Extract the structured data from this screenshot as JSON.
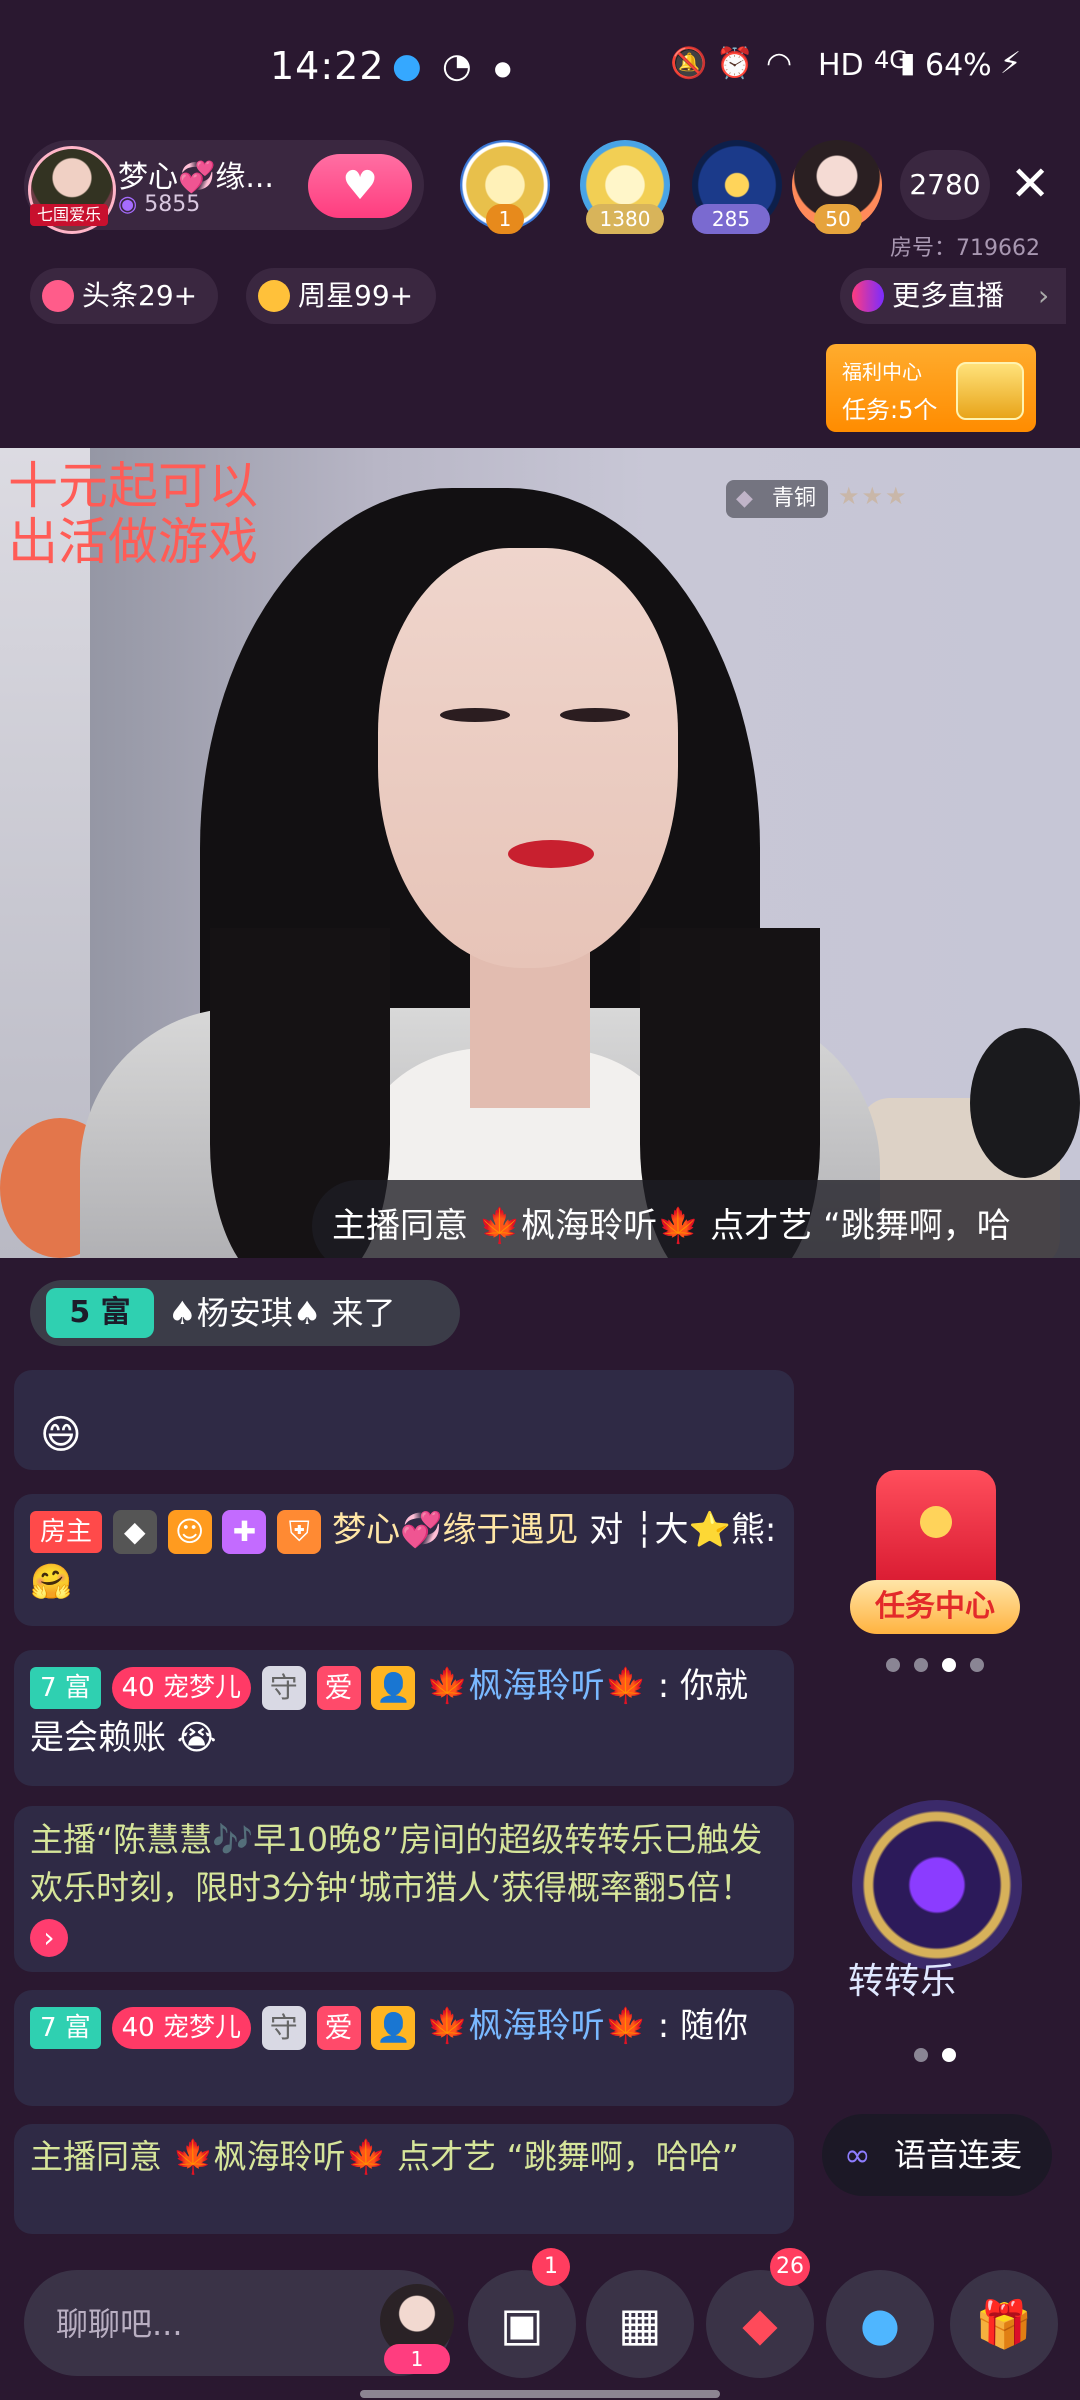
{
  "status_bar": {
    "time": "14:22",
    "hd": "HD",
    "net": "4G",
    "battery": "64%"
  },
  "header": {
    "anchor_name": "梦心💞缘...",
    "anchor_fans": "5855",
    "anchor_avatar_tag": "七国爱乐",
    "follow_icon": "♥",
    "vip_badges": [
      "1",
      "1380",
      "285",
      "50"
    ],
    "viewer_count": "2780",
    "room_no": "房号：719662"
  },
  "pills": {
    "headline": "头条29+",
    "weekstar": "周星99+",
    "more_live": "更多直播"
  },
  "welfare": {
    "title": "福利中心",
    "tasks": "任务:5个"
  },
  "video": {
    "overlay_text_line1": "十元起可以",
    "overlay_text_line2": "出活做游戏",
    "rank": "青铜",
    "stars": "★★★",
    "scroll_msg": "主播同意 🍁枫海聆听🍁 点才艺 “跳舞啊，哈"
  },
  "enter_notice": {
    "level": "5 富",
    "text": "♠杨安琪♠ 来了"
  },
  "chat": {
    "partial_emoji": "😄",
    "msg1": {
      "tag": "房主",
      "name": "梦心💞缘于遇见",
      "text": "对 ┆大⭐熊: 🤗"
    },
    "msg2": {
      "level": "7 富",
      "badge": "40 宠梦儿",
      "ai": "爱",
      "name": "🍁枫海聆听🍁",
      "text": ": 你就是会赖账 😭"
    },
    "msg3": {
      "text": "主播“陈慧慧🎶早10晚8”房间的超级转转乐已触发欢乐时刻，限时3分钟‘城市猎人’获得概率翻5倍！"
    },
    "msg4": {
      "level": "7 富",
      "badge": "40 宠梦儿",
      "ai": "爱",
      "name": "🍁枫海聆听🍁",
      "text": ": 随你"
    },
    "msg5": {
      "text": "主播同意 🍁枫海聆听🍁 点才艺 “跳舞啊，哈哈”"
    }
  },
  "right_panel": {
    "task_center": "任务中心",
    "wheel_label": "转转乐",
    "voice_link": "语音连麦"
  },
  "bottom_bar": {
    "chat_placeholder": "聊聊吧...",
    "avatar_badge": "1",
    "message_badge": "1",
    "gift_badge": "26"
  }
}
